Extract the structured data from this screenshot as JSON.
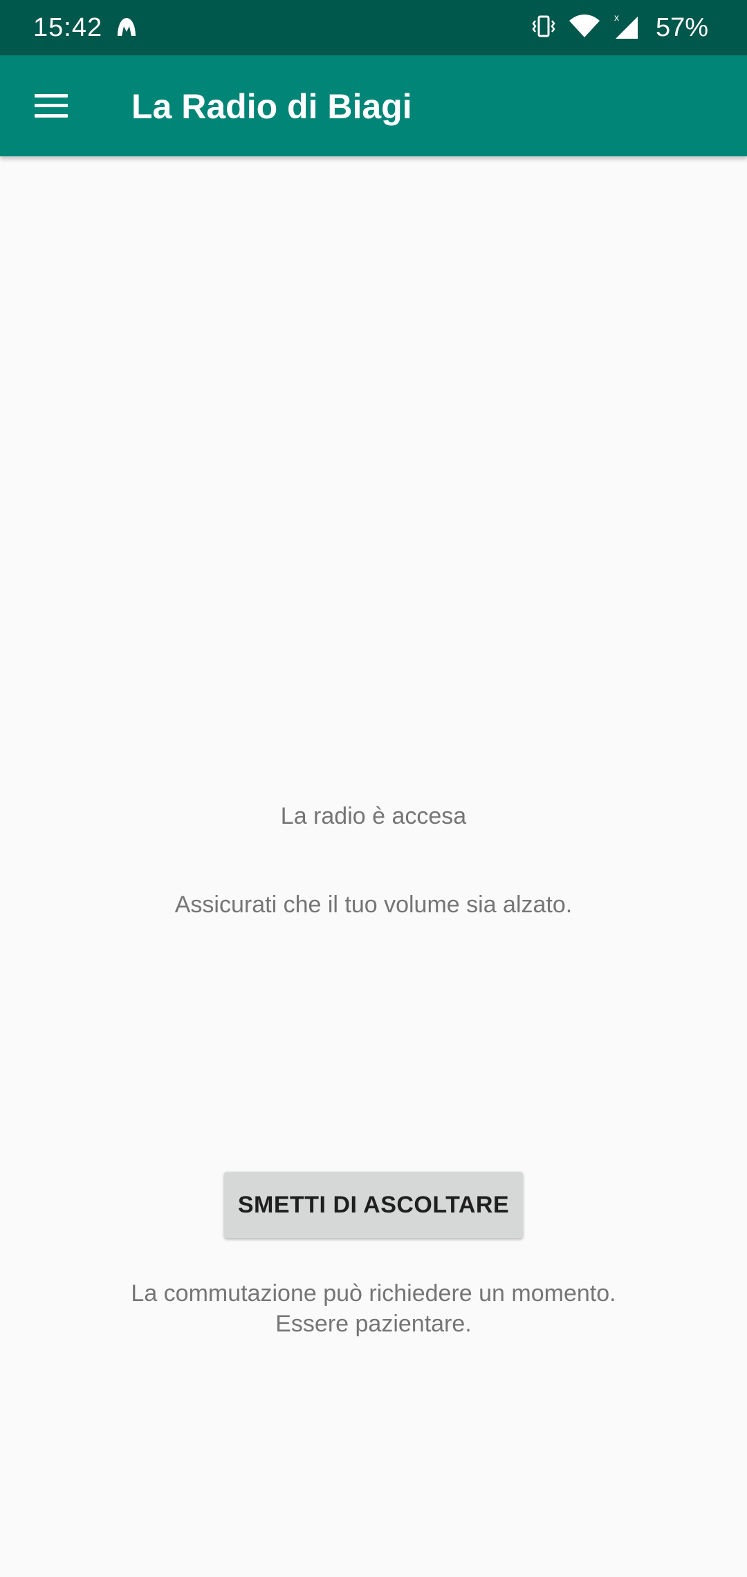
{
  "status_bar": {
    "time": "15:42",
    "battery_percent": "57%",
    "icons": [
      "notification-app-icon",
      "vibrate-icon",
      "wifi-icon",
      "signal-icon"
    ],
    "background_color": "#00574b"
  },
  "app_bar": {
    "menu_icon": "hamburger-menu-icon",
    "title": "La Radio di Biagi",
    "background_color": "#008577"
  },
  "main": {
    "radio_status": "La radio è accesa",
    "volume_hint": "Assicurati che il tuo volume sia alzato.",
    "stop_button_label": "SMETTI DI ASCOLTARE",
    "switch_note_line1": "La commutazione può richiedere un momento.",
    "switch_note_line2": "Essere pazientare."
  }
}
